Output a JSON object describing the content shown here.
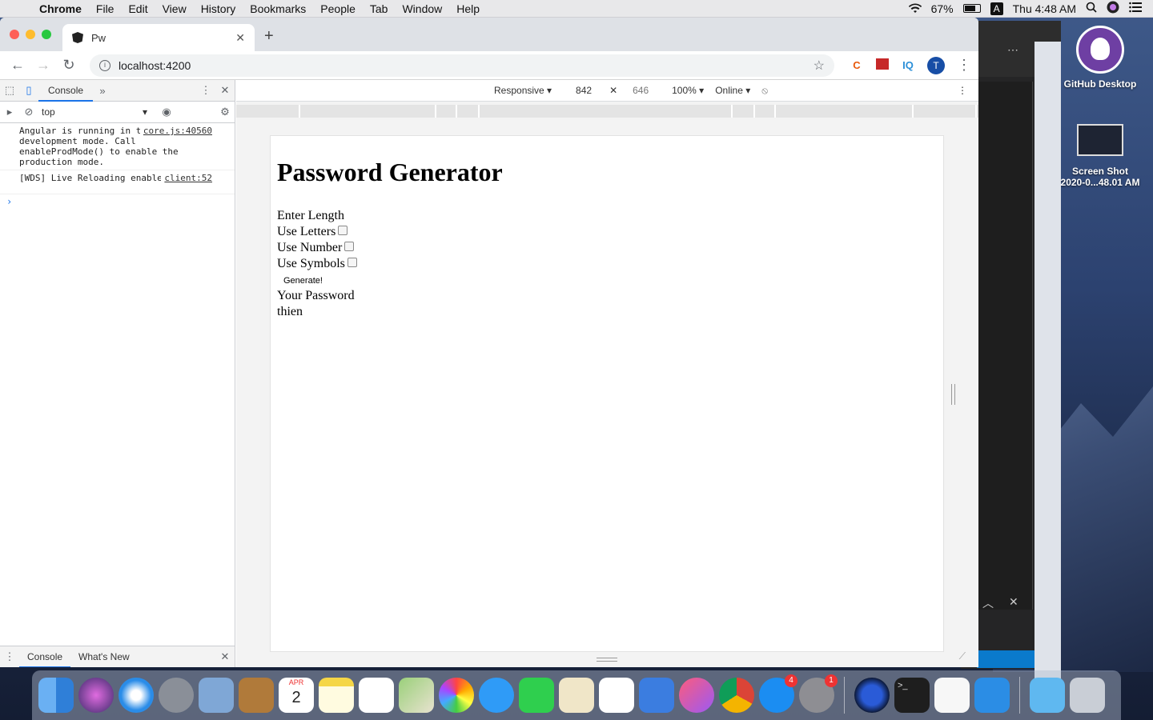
{
  "menubar": {
    "app": "Chrome",
    "items": [
      "File",
      "Edit",
      "View",
      "History",
      "Bookmarks",
      "People",
      "Tab",
      "Window",
      "Help"
    ],
    "battery": "67%",
    "input_source": "A",
    "clock": "Thu 4:48 AM"
  },
  "desktop": {
    "icons": [
      {
        "label": "GitHub Desktop"
      },
      {
        "label": "Screen Shot",
        "label2": "2020-0...48.01 AM"
      }
    ]
  },
  "browser": {
    "tab_title": "Pw",
    "url": "localhost:4200",
    "avatar_letter": "T"
  },
  "devtools": {
    "tab": "Console",
    "context": "top",
    "logs": [
      {
        "text": "Angular is running in the development mode. Call enableProdMode() to enable the production mode.",
        "source": "core.js:40560"
      },
      {
        "text": "[WDS] Live Reloading enabled.",
        "source": "client:52"
      }
    ],
    "drawer_tabs": [
      "Console",
      "What's New"
    ]
  },
  "device_toolbar": {
    "mode": "Responsive",
    "width": "842",
    "height": "646",
    "zoom": "100%",
    "network": "Online"
  },
  "page": {
    "title": "Password Generator",
    "length_label": "Enter Length",
    "letters_label": "Use Letters",
    "numbers_label": "Use Number",
    "symbols_label": "Use Symbols",
    "button_label": "Generate!",
    "result_label": "Your Password",
    "result_value": "thien",
    "letters_checked": false,
    "numbers_checked": false,
    "symbols_checked": false
  },
  "dock": {
    "badges": {
      "app_store": "4",
      "system_preferences": "1"
    },
    "calendar_month": "APR",
    "calendar_day": "2"
  }
}
